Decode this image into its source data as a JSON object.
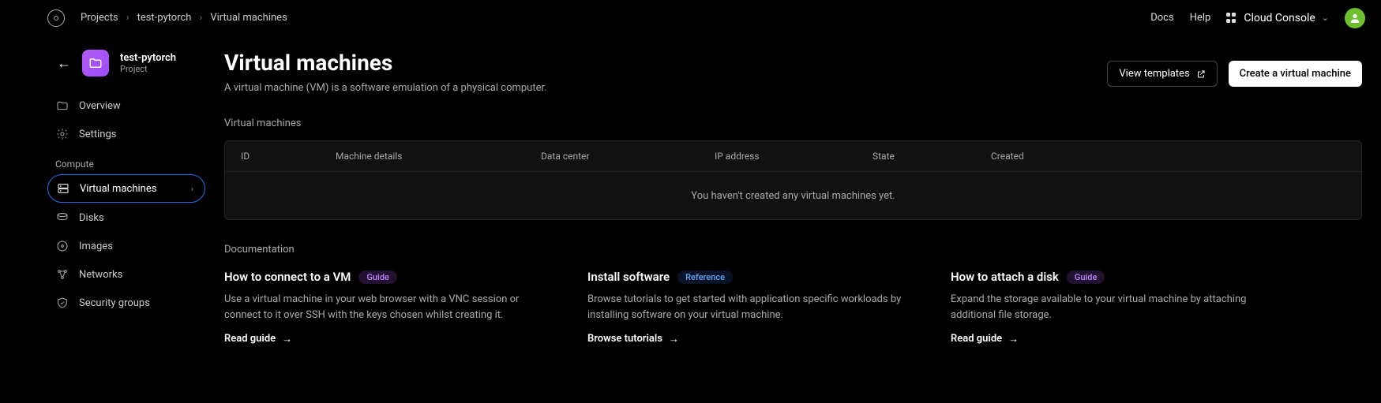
{
  "breadcrumbs": {
    "item0": "Projects",
    "item1": "test-pytorch",
    "item2": "Virtual machines"
  },
  "topnav": {
    "docs": "Docs",
    "help": "Help",
    "console": "Cloud Console"
  },
  "project": {
    "name": "test-pytorch",
    "subtitle": "Project"
  },
  "sidebar": {
    "overview": "Overview",
    "settings": "Settings",
    "group": "Compute",
    "vm": "Virtual machines",
    "disks": "Disks",
    "images": "Images",
    "networks": "Networks",
    "security": "Security groups"
  },
  "page": {
    "title": "Virtual machines",
    "subtitle": "A virtual machine (VM) is a software emulation of a physical computer."
  },
  "buttons": {
    "templates": "View templates",
    "create": "Create a virtual machine"
  },
  "section": {
    "vms": "Virtual machines",
    "docs": "Documentation"
  },
  "table": {
    "id": "ID",
    "machine": "Machine details",
    "dc": "Data center",
    "ip": "IP address",
    "state": "State",
    "created": "Created",
    "empty": "You haven't created any virtual machines yet."
  },
  "docs": {
    "card0": {
      "title": "How to connect to a VM",
      "badge": "Guide",
      "desc": "Use a virtual machine in your web browser with a VNC session or connect to it over SSH with the keys chosen whilst creating it.",
      "link": "Read guide"
    },
    "card1": {
      "title": "Install software",
      "badge": "Reference",
      "desc": "Browse tutorials to get started with application specific workloads by installing software on your virtual machine.",
      "link": "Browse tutorials"
    },
    "card2": {
      "title": "How to attach a disk",
      "badge": "Guide",
      "desc": "Expand the storage available to your virtual machine by attaching additional file storage.",
      "link": "Read guide"
    }
  }
}
